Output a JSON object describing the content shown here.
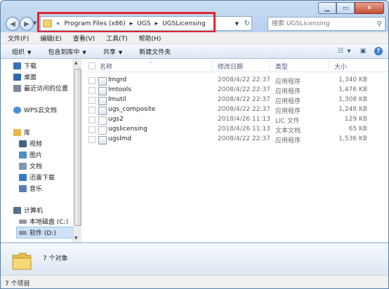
{
  "window": {
    "caption_minimize": "▁",
    "caption_maximize": "▭",
    "caption_close": "✕"
  },
  "address": {
    "prefix": "«",
    "crumbs": [
      "Program Files (x86)",
      "UGS",
      "UGSLicensing"
    ],
    "separator": "▸"
  },
  "search": {
    "placeholder": "搜索 UGSLicensing"
  },
  "menu": [
    "文件(F)",
    "编辑(E)",
    "查看(V)",
    "工具(T)",
    "帮助(H)"
  ],
  "toolbar": {
    "organize": "组织",
    "include_library": "包含到库中",
    "share": "共享",
    "new_folder": "新建文件夹"
  },
  "nav": {
    "items": [
      {
        "label": "下载",
        "icon": "download-folder-icon",
        "color": "#3b6fb8"
      },
      {
        "label": "桌面",
        "icon": "desktop-icon",
        "color": "#2f66b0"
      },
      {
        "label": "最近访问的位置",
        "icon": "recent-places-icon",
        "color": "#7a8898"
      },
      {
        "label": "WPS云文档",
        "icon": "wps-cloud-icon",
        "color": "#4a8fd8"
      },
      {
        "label": "库",
        "icon": "library-icon",
        "color": "#e8b84a"
      },
      {
        "label": "视频",
        "icon": "video-icon",
        "color": "#44617f"
      },
      {
        "label": "图片",
        "icon": "pictures-icon",
        "color": "#4f8fc2"
      },
      {
        "label": "文档",
        "icon": "documents-icon",
        "color": "#7f96b3"
      },
      {
        "label": "迅雷下载",
        "icon": "xunlei-download-icon",
        "color": "#3a78c4"
      },
      {
        "label": "音乐",
        "icon": "music-icon",
        "color": "#5a7fb2"
      },
      {
        "label": "计算机",
        "icon": "computer-icon",
        "color": "#55708f"
      },
      {
        "label": "本地磁盘 (C:)",
        "icon": "local-disk-icon",
        "color": "#8d97a3"
      },
      {
        "label": "软件 (D:)",
        "icon": "software-disk-icon",
        "color": "#8d97a3"
      }
    ]
  },
  "columns": {
    "name": "名称",
    "date": "修改日期",
    "type": "类型",
    "size": "大小"
  },
  "files": [
    {
      "name": "lmgrd",
      "date": "2008/4/22 22:37",
      "type": "应用程序",
      "size": "1,340 KB",
      "icon": "exe-icon"
    },
    {
      "name": "lmtools",
      "date": "2008/4/22 22:37",
      "type": "应用程序",
      "size": "1,476 KB",
      "icon": "exe-icon"
    },
    {
      "name": "lmutil",
      "date": "2008/4/22 22:37",
      "type": "应用程序",
      "size": "1,308 KB",
      "icon": "exe-icon"
    },
    {
      "name": "ugs_composite",
      "date": "2008/4/22 22:37",
      "type": "应用程序",
      "size": "1,248 KB",
      "icon": "exe-icon"
    },
    {
      "name": "ugs2",
      "date": "2018/4/26 11:13",
      "type": "LIC 文件",
      "size": "129 KB",
      "icon": "lic-file-icon"
    },
    {
      "name": "ugslicensing",
      "date": "2018/4/26 11:13",
      "type": "文本文档",
      "size": "65 KB",
      "icon": "text-file-icon"
    },
    {
      "name": "ugslmd",
      "date": "2008/4/22 22:37",
      "type": "应用程序",
      "size": "1,536 KB",
      "icon": "exe-icon"
    }
  ],
  "details": {
    "count": "7 个对象"
  },
  "status": {
    "text": "7 个项目"
  },
  "colors": {
    "highlight_box": "#e3262e",
    "selection": "#cde2f7",
    "accent": "#3d7fc8"
  }
}
